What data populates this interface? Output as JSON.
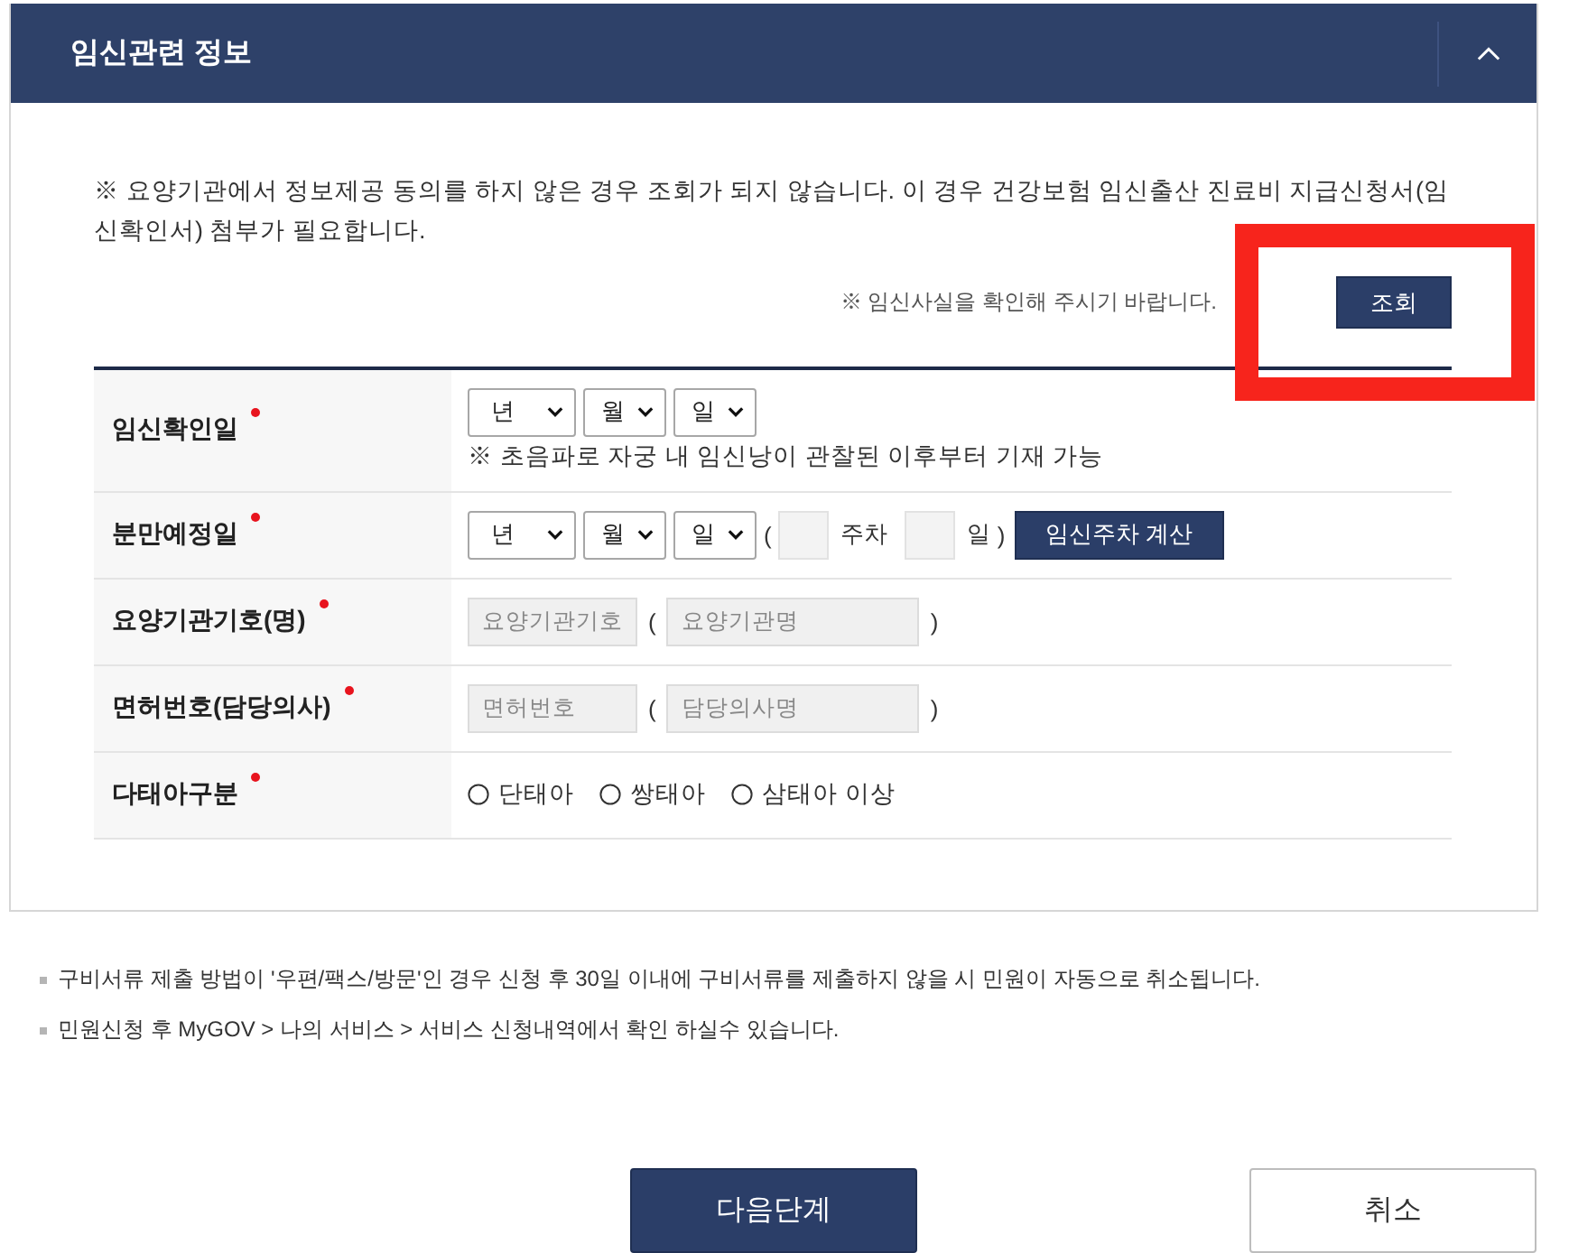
{
  "panel": {
    "title": "임신관련 정보",
    "expanded": true,
    "notice": "※ 요양기관에서 정보제공 동의를 하지 않은 경우 조회가 되지 않습니다. 이 경우 건강보험 임신출산 진료비 지급신청서(임신확인서) 첨부가 필요합니다.",
    "lookup_hint": "※ 임신사실을 확인해 주시기 바랍니다.",
    "lookup_button": "조회",
    "rows": [
      {
        "kind": "date",
        "label": "임신확인일",
        "required": true,
        "selects": [
          "년",
          "월",
          "일"
        ],
        "note": "※ 초음파로 자궁 내 임신낭이 관찰된 이후부터 기재 가능"
      },
      {
        "kind": "date-weeks",
        "label": "분만예정일",
        "required": true,
        "selects": [
          "년",
          "월",
          "일"
        ],
        "open_paren": "(",
        "weeks_unit": "주차",
        "days_unit": "일",
        "close_paren": ")",
        "button": "임신주차 계산"
      },
      {
        "kind": "pair",
        "label": "요양기관기호(명)",
        "required": true,
        "code_placeholder": "요양기관기호",
        "open_paren": "(",
        "name_placeholder": "요양기관명",
        "close_paren": ")"
      },
      {
        "kind": "pair",
        "label": "면허번호(담당의사)",
        "required": true,
        "code_placeholder": "면허번호",
        "open_paren": "(",
        "name_placeholder": "담당의사명",
        "close_paren": ")"
      },
      {
        "kind": "radio",
        "label": "다태아구분",
        "required": true,
        "options": [
          {
            "label": "단태아",
            "selected": false
          },
          {
            "label": "쌍태아",
            "selected": false
          },
          {
            "label": "삼태아 이상",
            "selected": false
          }
        ]
      }
    ]
  },
  "annotations": [
    {
      "kind": "frame"
    }
  ],
  "notes": [
    "구비서류 제출 방법이 '우편/팩스/방문'인 경우 신청 후 30일 이내에 구비서류를 제출하지 않을 시 민원이 자동으로 취소됩니다.",
    "민원신청 후 MyGOV > 나의 서비스 > 서비스 신청내역에서 확인 하실수 있습니다."
  ],
  "buttons": [
    {
      "label": "다음단계",
      "kind": "primary"
    },
    {
      "label": "취소",
      "kind": "secondary"
    }
  ]
}
